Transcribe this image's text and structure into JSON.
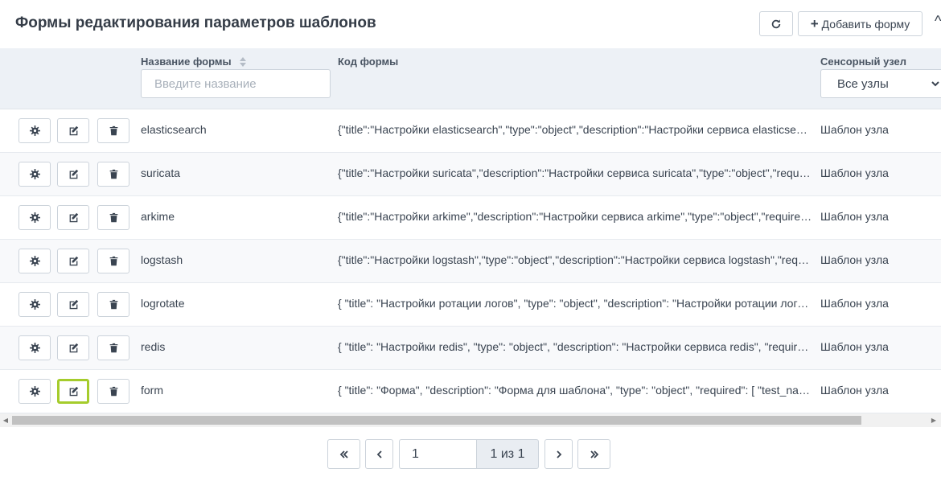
{
  "header": {
    "title": "Формы редактирования параметров шаблонов",
    "add_label": "Добавить форму",
    "add_icon": "plus-icon",
    "refresh_icon": "refresh-icon"
  },
  "table": {
    "columns": {
      "name": "Название формы",
      "code": "Код формы",
      "sensor": "Сенсорный узел"
    },
    "filters": {
      "name_placeholder": "Введите название",
      "sensor_value": "Все узлы"
    },
    "rows": [
      {
        "name": "elasticsearch",
        "code": "{\"title\":\"Настройки elasticsearch\",\"type\":\"object\",\"description\":\"Настройки сервиса elasticsearch\"...",
        "sensor": "Шаблон узла"
      },
      {
        "name": "suricata",
        "code": "{\"title\":\"Настройки suricata\",\"description\":\"Настройки сервиса suricata\",\"type\":\"object\",\"required\"...",
        "sensor": "Шаблон узла"
      },
      {
        "name": "arkime",
        "code": "{\"title\":\"Настройки arkime\",\"description\":\"Настройки сервиса arkime\",\"type\":\"object\",\"required\"...",
        "sensor": "Шаблон узла"
      },
      {
        "name": "logstash",
        "code": "{\"title\":\"Настройки logstash\",\"type\":\"object\",\"description\":\"Настройки сервиса logstash\",\"required\"...",
        "sensor": "Шаблон узла"
      },
      {
        "name": "logrotate",
        "code": "{ \"title\": \"Настройки ротации логов\", \"type\": \"object\", \"description\": \"Настройки ротации логов\"...",
        "sensor": "Шаблон узла"
      },
      {
        "name": "redis",
        "code": "{ \"title\": \"Настройки redis\", \"type\": \"object\", \"description\": \"Настройки сервиса redis\", \"required\"...",
        "sensor": "Шаблон узла"
      },
      {
        "name": "form",
        "code": "{ \"title\": \"Форма\", \"description\": \"Форма для шаблона\", \"type\": \"object\", \"required\": [ \"test_name\" ]...",
        "sensor": "Шаблон узла"
      }
    ],
    "row_actions": [
      "gear-icon",
      "edit-icon",
      "trash-icon"
    ]
  },
  "pagination": {
    "current_page": "1",
    "info": "1 из 1"
  },
  "colors": {
    "header_bg": "#edf1f6",
    "focus_outline": "#a5cc2c",
    "text": "#3a4451"
  }
}
